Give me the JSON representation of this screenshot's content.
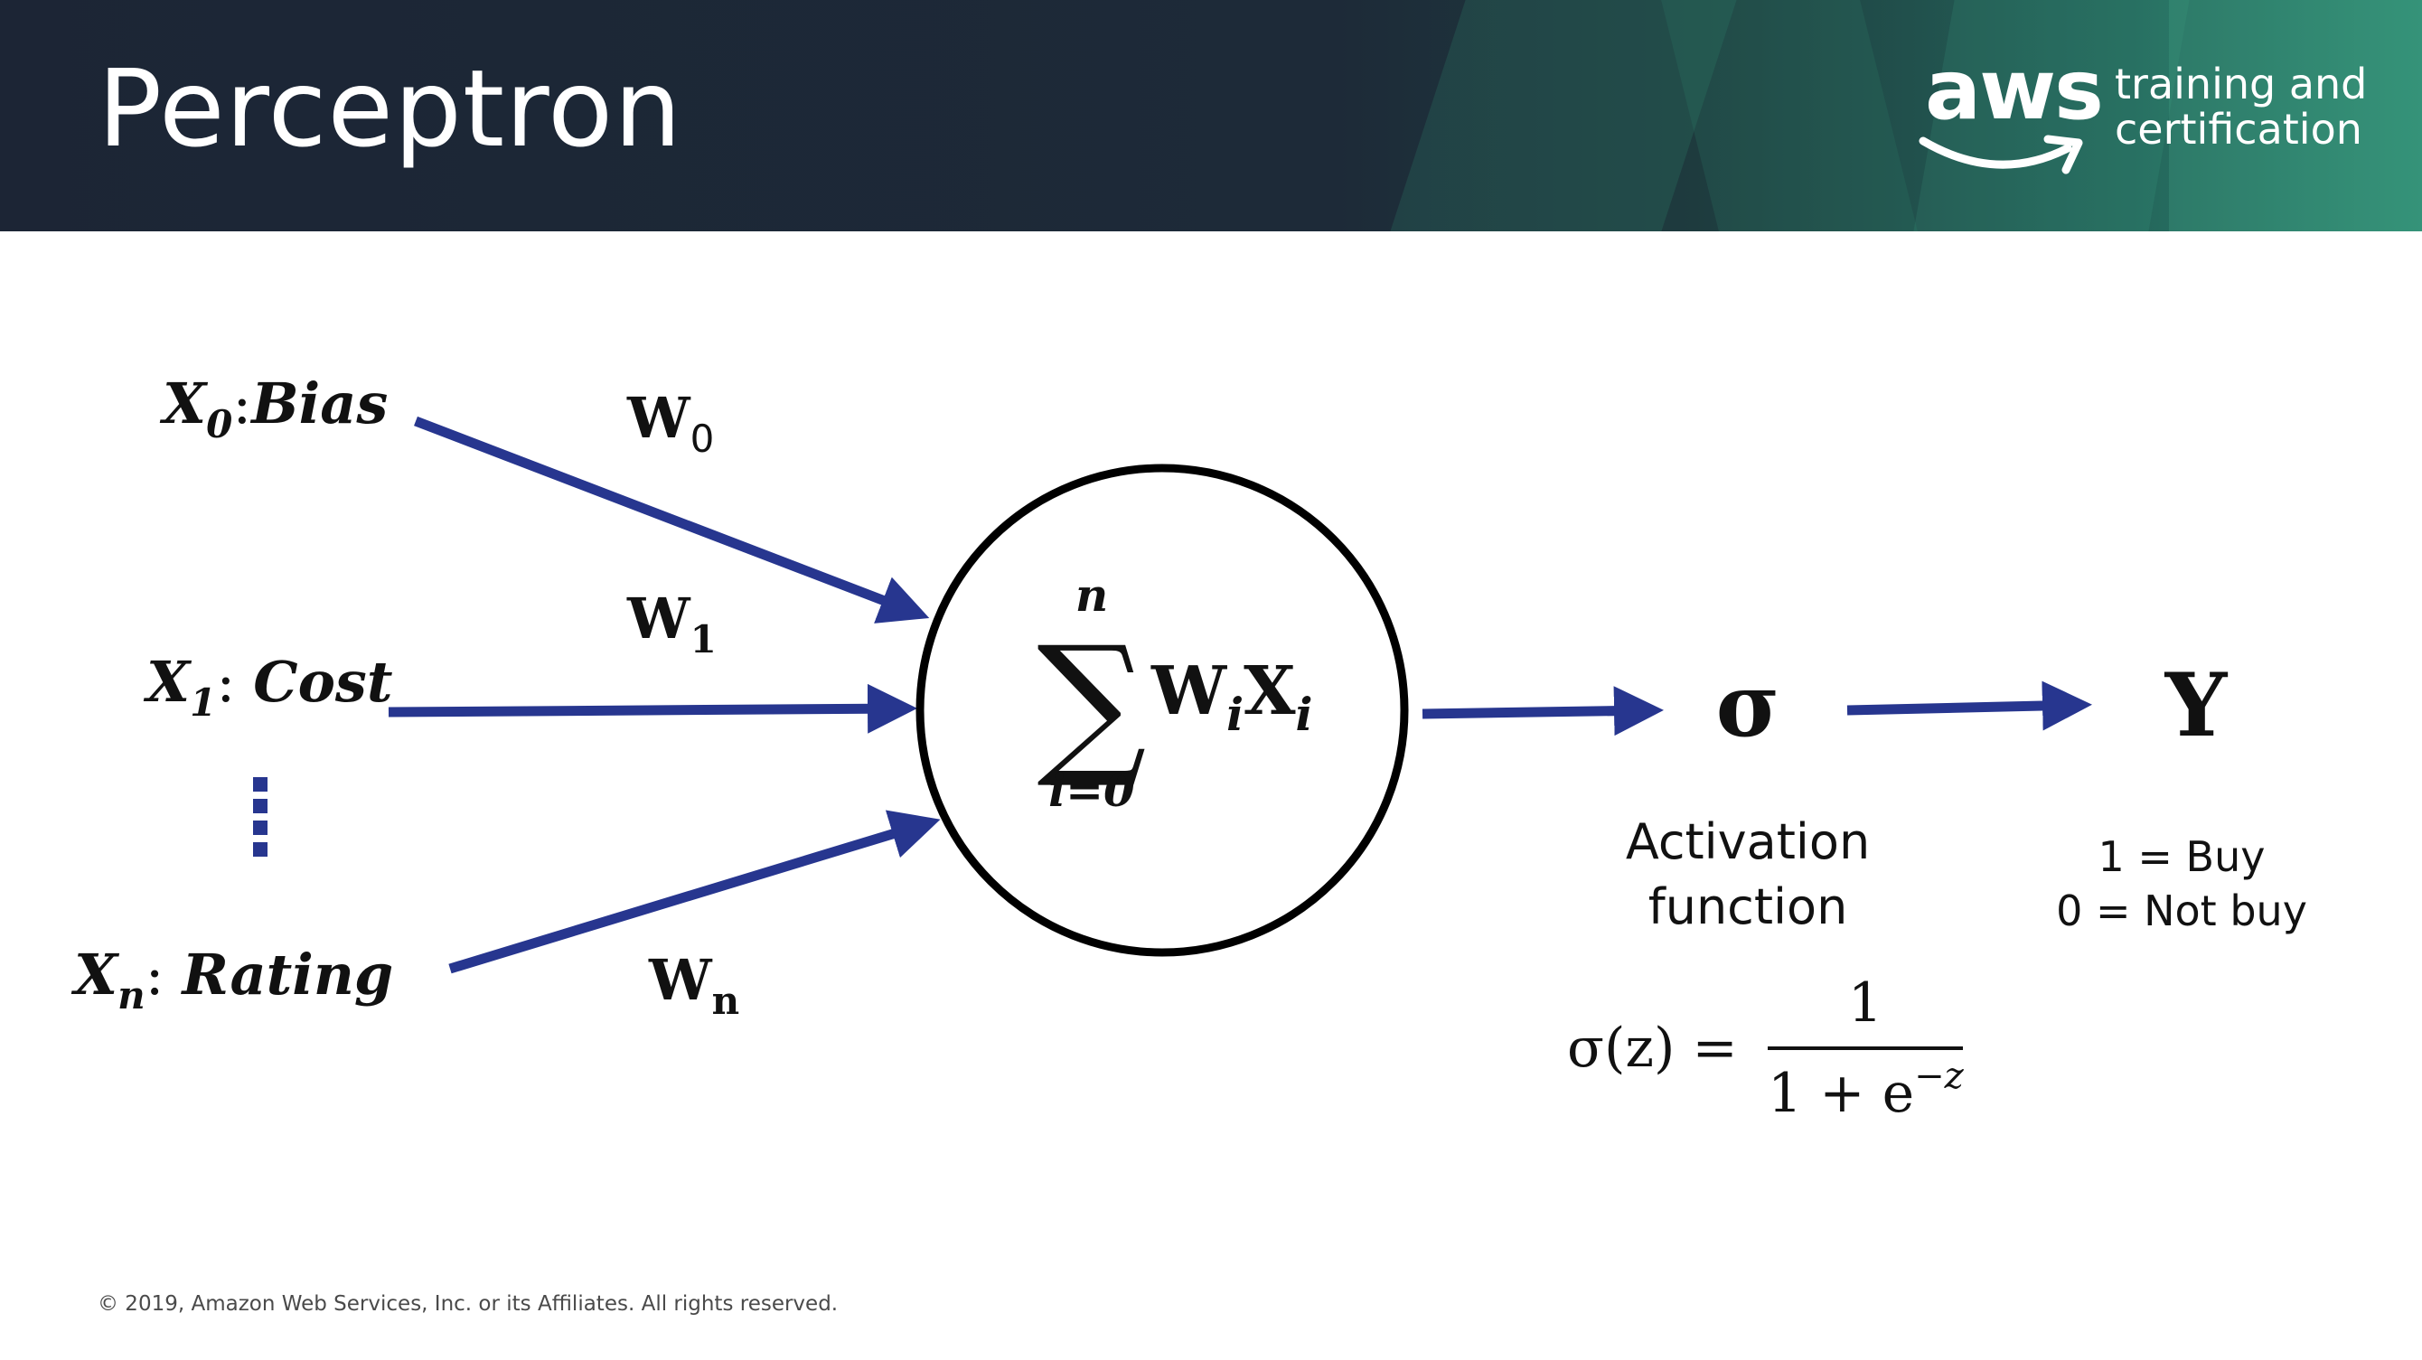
{
  "header": {
    "title": "Perceptron",
    "logo": {
      "wordmark": "aws",
      "line1": "training and",
      "line2": "certification"
    }
  },
  "inputs": [
    {
      "var": "X",
      "sub": "0",
      "sep": ":",
      "label": "Bias",
      "weight": "W",
      "weight_sub": "0"
    },
    {
      "var": "X",
      "sub": "1",
      "sep": ":",
      "label": "Cost",
      "weight": "W",
      "weight_sub": "1"
    },
    {
      "var": "X",
      "sub": "n",
      "sep": ":",
      "label": "Rating",
      "weight": "W",
      "weight_sub": "n"
    }
  ],
  "neuron": {
    "sum_top": "n",
    "sum_symbol": "∑",
    "sum_bottom": "i=0",
    "w": "W",
    "w_sub": "i",
    "x": "X",
    "x_sub": "i"
  },
  "activation": {
    "symbol": "σ",
    "label_line1": "Activation",
    "label_line2": "function",
    "formula": {
      "lhs": "σ(z) =",
      "numerator": "1",
      "denominator": "1 + e",
      "exponent": "−z"
    }
  },
  "output": {
    "symbol": "Y",
    "line1": "1 = Buy",
    "line2": "0 = Not buy"
  },
  "footer": {
    "copyright": "© 2019, Amazon Web Services, Inc. or its Affiliates. All rights reserved."
  },
  "colors": {
    "arrow": "#27368f",
    "header_dark": "#1c2535",
    "header_teal": "#2f8a72"
  }
}
